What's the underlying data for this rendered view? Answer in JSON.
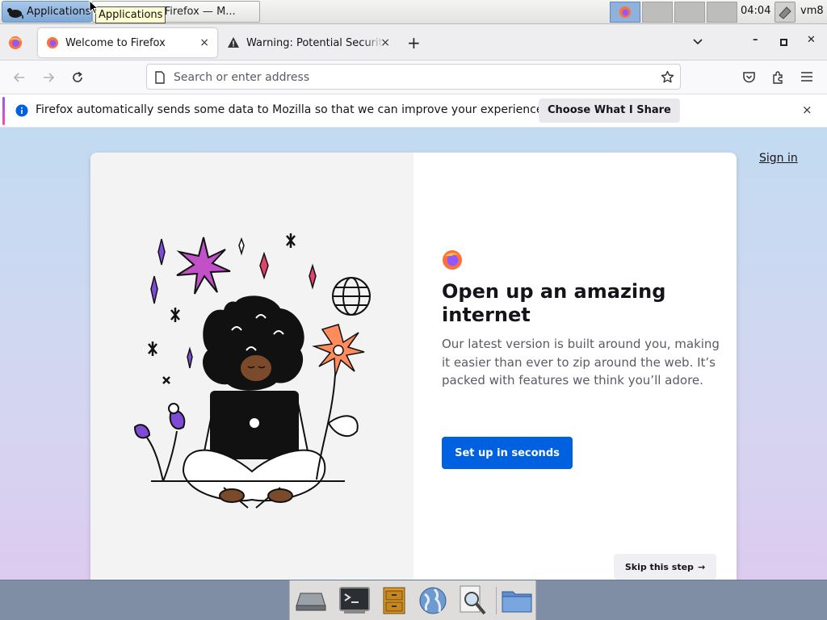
{
  "panel": {
    "applications_label": "Applications",
    "tooltip": "Applications",
    "task_title": "Welcome to Firefox — M...",
    "clock": "04:04",
    "user": "vm8"
  },
  "tabs": [
    {
      "title": "Welcome to Firefox",
      "close": "×",
      "icon": "firefox-icon"
    },
    {
      "title": "Warning: Potential Security Risk Ahead",
      "close": "×",
      "icon": "warning-icon"
    }
  ],
  "tabstrip": {
    "new_tab": "+",
    "list_all": "⌄",
    "minimize": "–",
    "maximize": "□",
    "close": "✕"
  },
  "navbar": {
    "url_placeholder": "Search or enter address"
  },
  "notification": {
    "message": "Firefox automatically sends some data to Mozilla so that we can improve your experience.",
    "button": "Choose What I Share",
    "close": "×"
  },
  "welcome": {
    "sign_in": "Sign in",
    "headline": "Open up an amazing internet",
    "body": "Our latest version is built around you, making it easier than ever to zip around the web. It’s packed with features we think you’ll adore.",
    "primary_button": "Set up in seconds",
    "skip_button": "Skip this step",
    "skip_arrow": "→"
  },
  "dock": [
    "drive-icon",
    "terminal-icon",
    "file-cabinet-icon",
    "web-browser-icon",
    "search-magnifier-icon",
    "folder-icon"
  ],
  "colors": {
    "accent": "#0061e0",
    "tab_bg": "#eeeef1",
    "page_gradient_top": "#c2dbf1",
    "page_gradient_bottom": "#dccbef"
  }
}
